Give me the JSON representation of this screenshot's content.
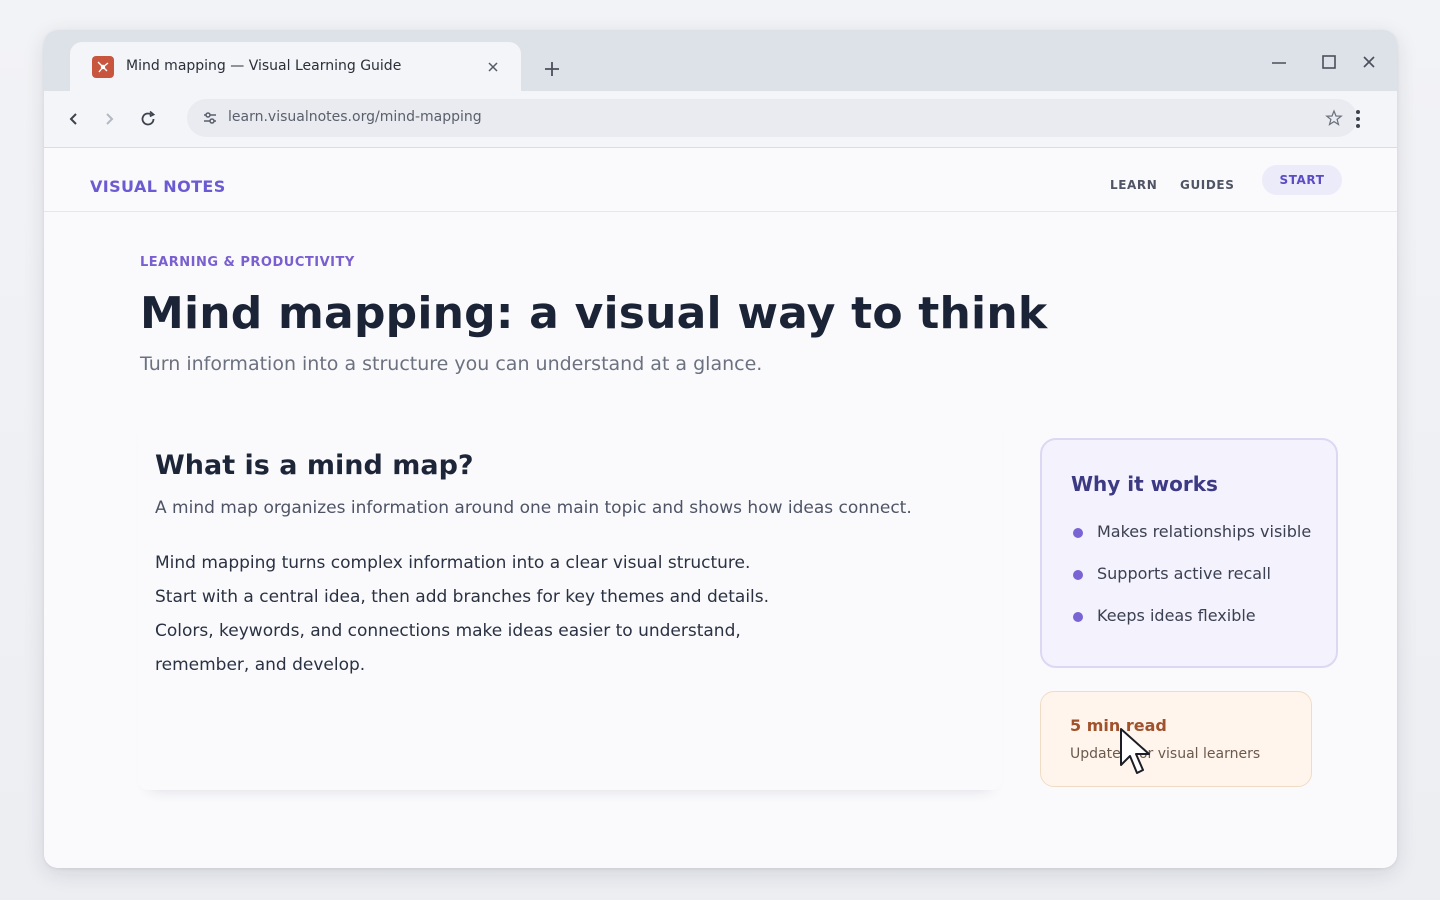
{
  "browser": {
    "tab": {
      "title": "Mind mapping — Visual Learning Guide",
      "favicon": "mind-map-favicon-icon"
    },
    "url": "learn.visualnotes.org/mind-mapping",
    "icons": [
      "back-icon",
      "forward-icon",
      "reload-icon",
      "site-info-icon",
      "bookmark-star-icon",
      "menu-kebab-icon",
      "new-tab-icon",
      "tab-close-icon",
      "minimize-icon",
      "maximize-icon",
      "close-window-icon"
    ]
  },
  "site": {
    "brand": "VISUAL NOTES",
    "nav": [
      "LEARN",
      "GUIDES"
    ],
    "cta": "START"
  },
  "article": {
    "eyebrow": "LEARNING & PRODUCTIVITY",
    "title": "Mind mapping: a visual way to think",
    "subtitle": "Turn information into a structure you can understand at a glance.",
    "section_heading": "What is a mind map?",
    "lead": "A mind map organizes information around one main topic and shows how ideas connect.",
    "body_lines": [
      "Mind mapping turns complex information into a clear visual structure.",
      "Start with a central idea, then add branches for key themes and details.",
      "Colors, keywords, and connections make ideas easier to understand,",
      "remember, and develop."
    ]
  },
  "why_card": {
    "title": "Why it works",
    "items": [
      "Makes relationships visible",
      "Supports active recall",
      "Keeps ideas flexible"
    ]
  },
  "read_card": {
    "title": "5 min read",
    "subtitle": "Updated for visual learners"
  },
  "colors": {
    "accent": "#6b5bd2",
    "heading": "#1b2336",
    "why_card_bg": "#f3f2fd",
    "read_card_bg": "#fff5ec",
    "read_card_title": "#a0522d"
  }
}
